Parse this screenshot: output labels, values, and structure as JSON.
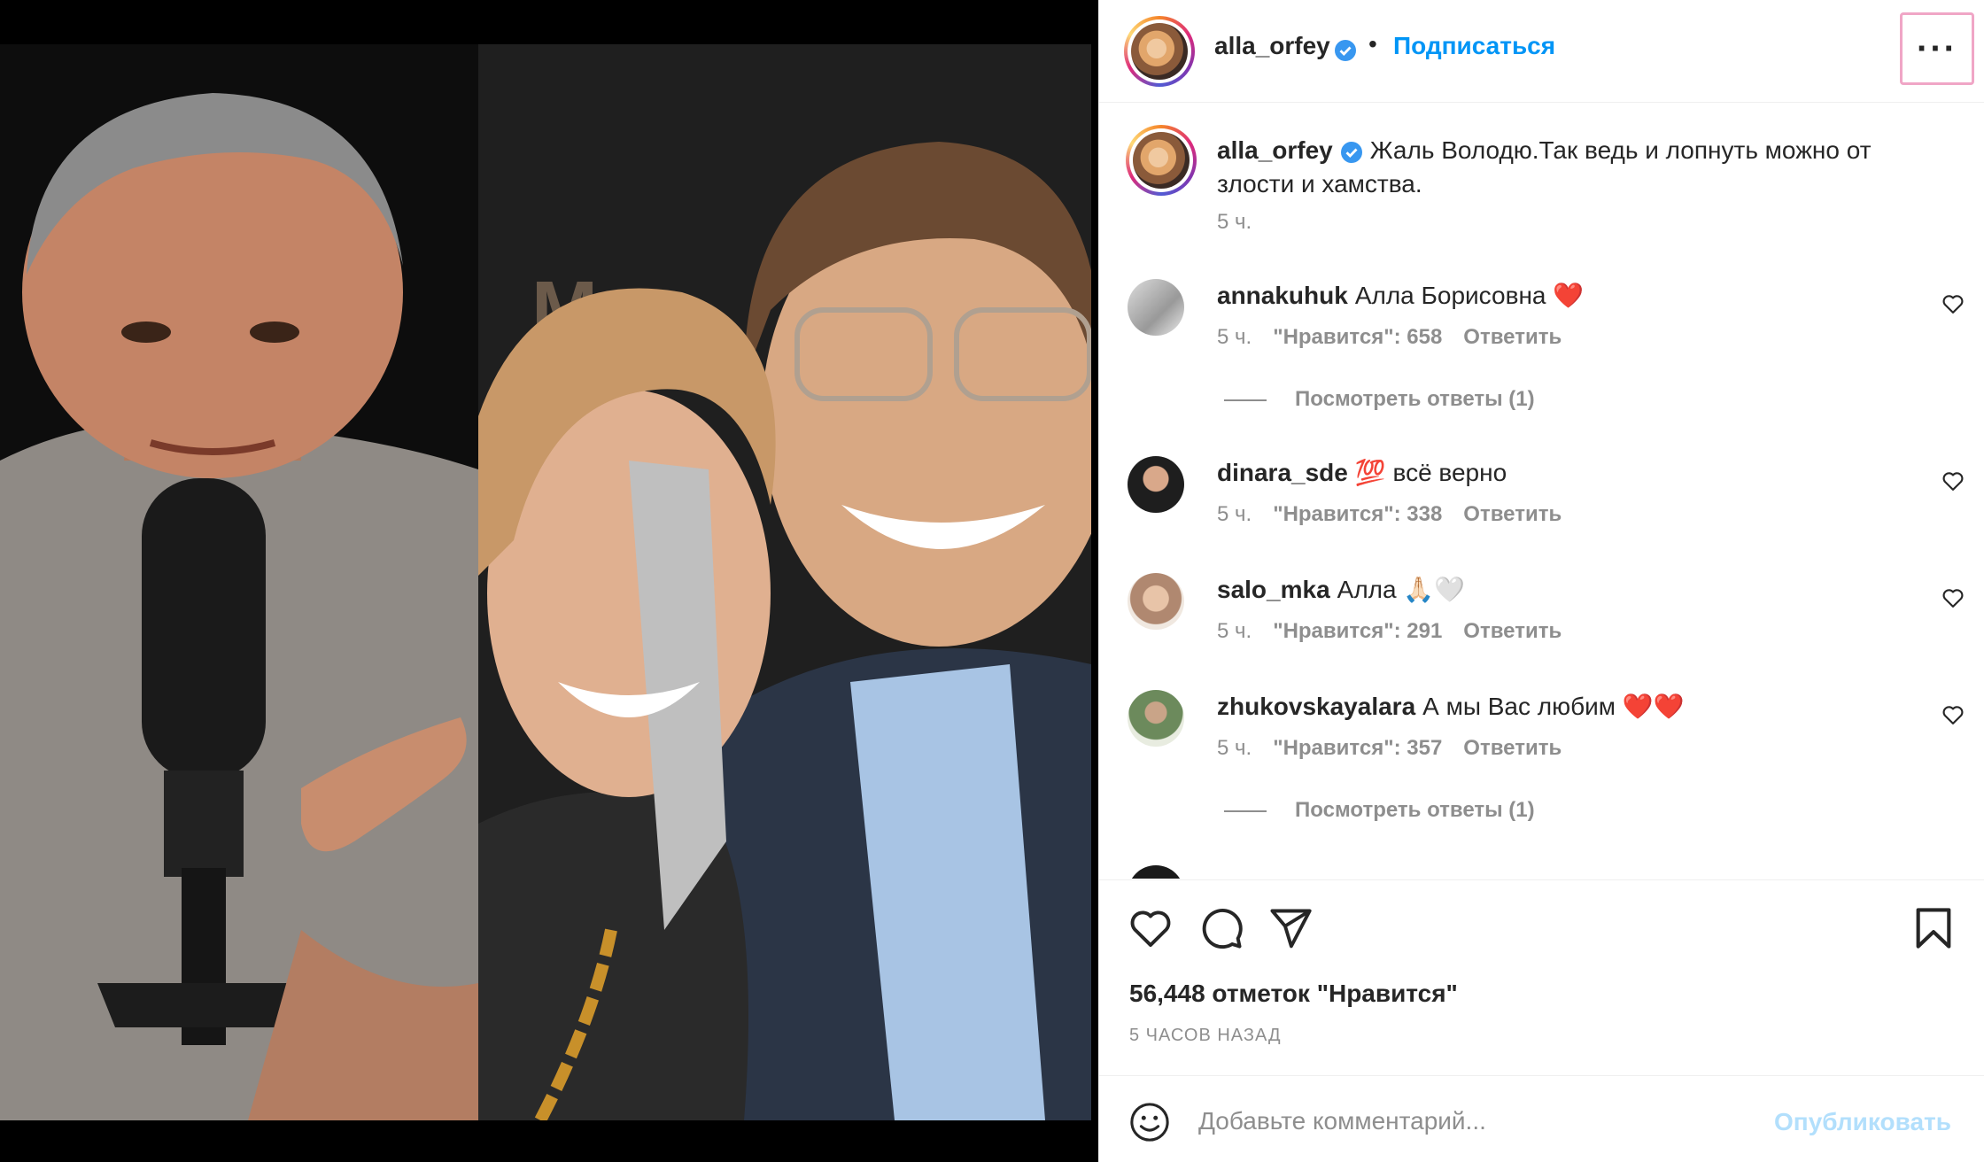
{
  "post": {
    "author": "alla_orfey",
    "verified": true,
    "follow_label": "Подписаться",
    "separator": "•",
    "more_label": "···"
  },
  "caption": {
    "author": "alla_orfey",
    "text": "Жаль Володю.Так ведь и лопнуть можно от злости и хамства.",
    "time": "5 ч."
  },
  "comments": [
    {
      "user": "annakuhuk",
      "text": "Алла Борисовна ❤️",
      "time": "5 ч.",
      "likes": "\"Нравится\": 658",
      "reply": "Ответить",
      "view_replies": "Посмотреть ответы (1)"
    },
    {
      "user": "dinara_sde",
      "text": "💯 всё верно",
      "time": "5 ч.",
      "likes": "\"Нравится\": 338",
      "reply": "Ответить"
    },
    {
      "user": "salo_mka",
      "text": "Алла 🙏🏻🤍",
      "time": "5 ч.",
      "likes": "\"Нравится\": 291",
      "reply": "Ответить"
    },
    {
      "user": "zhukovskayalara",
      "text": "А мы Вас любим ❤️❤️",
      "time": "5 ч.",
      "likes": "\"Нравится\": 357",
      "reply": "Ответить",
      "view_replies": "Посмотреть ответы (1)"
    }
  ],
  "footer": {
    "likes": "56,448 отметок \"Нравится\"",
    "ago": "5 ЧАСОВ НАЗАД"
  },
  "composer": {
    "placeholder": "Добавьте комментарий...",
    "publish": "Опубликовать"
  },
  "colors": {
    "link": "#0095f6",
    "muted": "#8e8e8e",
    "publish_disabled": "#b2dffc",
    "highlight_border": "#f0a6c6"
  },
  "icons": [
    "verified-badge-icon",
    "more-icon",
    "heart-icon",
    "comment-icon",
    "share-icon",
    "bookmark-icon",
    "emoji-icon"
  ]
}
